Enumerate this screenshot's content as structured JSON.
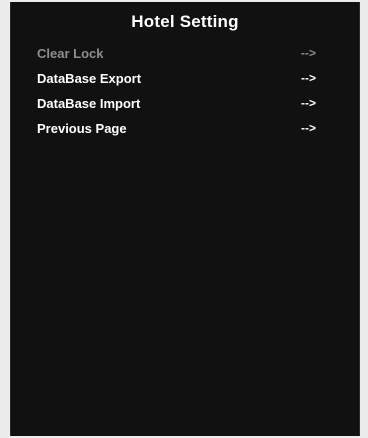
{
  "screen": {
    "title": "Hotel Setting"
  },
  "menu": {
    "items": [
      {
        "label": "Clear Lock",
        "arrow": "-->",
        "enabled": false
      },
      {
        "label": "DataBase Export",
        "arrow": "-->",
        "enabled": true
      },
      {
        "label": "DataBase Import",
        "arrow": "-->",
        "enabled": true
      },
      {
        "label": "Previous Page",
        "arrow": "-->",
        "enabled": true
      }
    ]
  },
  "colors": {
    "background": "#111111",
    "text": "#ffffff",
    "disabled_text": "#8e8e8e"
  }
}
